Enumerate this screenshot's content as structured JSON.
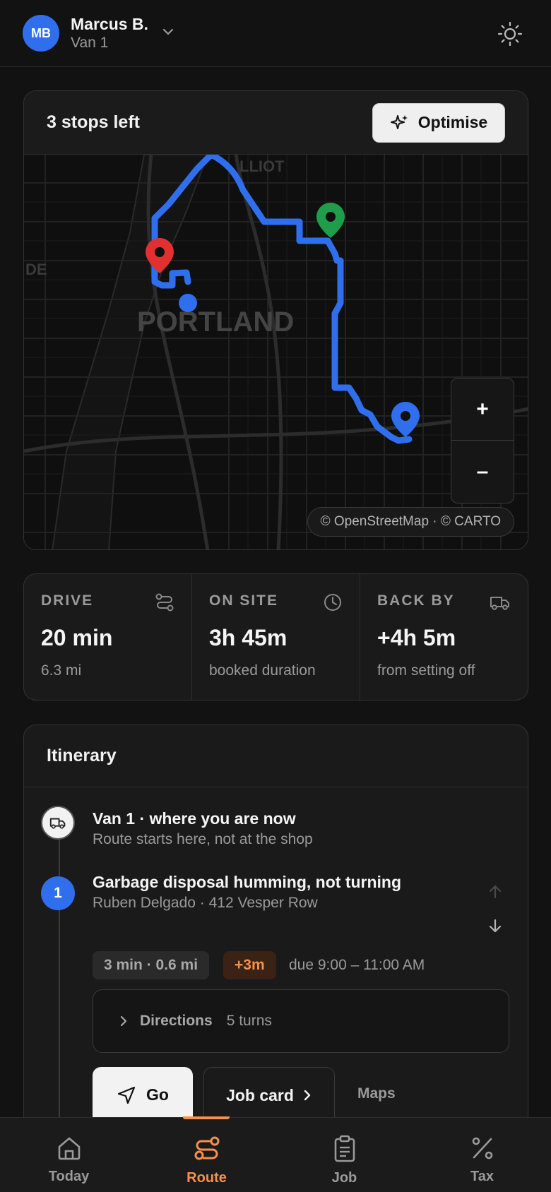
{
  "header": {
    "avatar_initials": "MB",
    "user_name": "Marcus B.",
    "vehicle": "Van 1"
  },
  "map_card": {
    "title": "3 stops left",
    "optimise_label": "Optimise",
    "city_label": "PORTLAND",
    "district_label_1": "LLIOT",
    "district_label_2": "DE",
    "zoom_in": "+",
    "zoom_out": "–",
    "attribution": "© OpenStreetMap · © CARTO",
    "marker_colors": {
      "route": "#2f6fed",
      "stop_red": "#e0302f",
      "stop_green": "#1e9e4a",
      "stop_blue": "#2f6fed"
    }
  },
  "stats": [
    {
      "label": "DRIVE",
      "value": "20 min",
      "sub": "6.3 mi",
      "icon": "route-icon"
    },
    {
      "label": "ON SITE",
      "value": "3h 45m",
      "sub": "booked duration",
      "icon": "clock-icon"
    },
    {
      "label": "BACK BY",
      "value": "+4h 5m",
      "sub": "from setting off",
      "icon": "truck-icon"
    }
  ],
  "itinerary": {
    "title": "Itinerary",
    "start": {
      "title": "Van 1 · where you are now",
      "sub": "Route starts here, not at the shop"
    },
    "stop1": {
      "number": "1",
      "title": "Garbage disposal humming, not turning",
      "sub": "Ruben Delgado · 412 Vesper Row",
      "distance": "3 min · 0.6 mi",
      "delay": "+3m",
      "due": "due 9:00 – 11:00 AM",
      "directions_label": "Directions",
      "directions_turns": "5 turns",
      "go_label": "Go",
      "job_card_label": "Job card",
      "maps_label": "Maps"
    }
  },
  "nav": [
    {
      "label": "Today",
      "icon": "home-icon"
    },
    {
      "label": "Route",
      "icon": "route-icon",
      "active": true
    },
    {
      "label": "Job",
      "icon": "clipboard-icon"
    },
    {
      "label": "Tax",
      "icon": "percent-icon"
    }
  ],
  "colors": {
    "accent": "#f7904a",
    "primary": "#2f6fed",
    "background": "#121212"
  }
}
